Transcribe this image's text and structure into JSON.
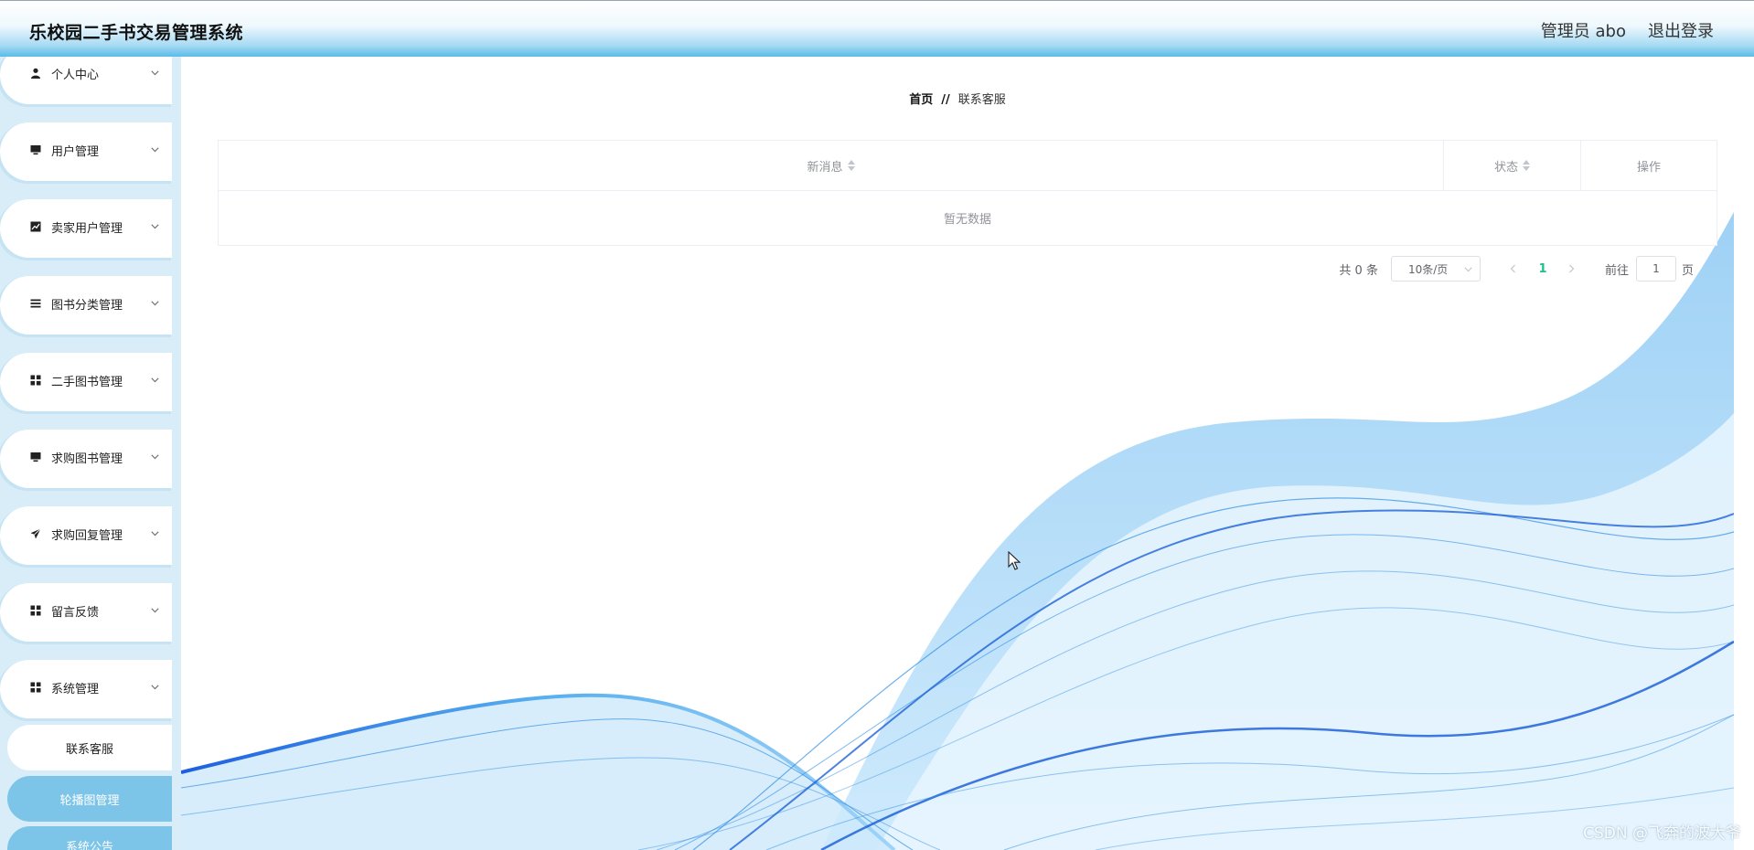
{
  "header": {
    "title": "乐校园二手书交易管理系统",
    "user_label": "管理员 abo",
    "logout_label": "退出登录"
  },
  "sidebar": {
    "items": [
      {
        "label": "个人中心",
        "icon": "user-icon"
      },
      {
        "label": "用户管理",
        "icon": "monitor-icon"
      },
      {
        "label": "卖家用户管理",
        "icon": "chart-icon"
      },
      {
        "label": "图书分类管理",
        "icon": "list-icon"
      },
      {
        "label": "二手图书管理",
        "icon": "grid-icon"
      },
      {
        "label": "求购图书管理",
        "icon": "monitor-icon"
      },
      {
        "label": "求购回复管理",
        "icon": "send-icon"
      },
      {
        "label": "留言反馈",
        "icon": "grid-icon"
      },
      {
        "label": "系统管理",
        "icon": "grid-icon"
      }
    ],
    "sub_items": [
      {
        "label": "联系客服",
        "active": true
      },
      {
        "label": "轮播图管理",
        "active": false
      },
      {
        "label": "系统公告",
        "active": false
      }
    ]
  },
  "breadcrumb": {
    "home": "首页",
    "separator": "//",
    "current": "联系客服"
  },
  "table": {
    "columns": [
      {
        "label": "新消息",
        "sortable": true
      },
      {
        "label": "状态",
        "sortable": true
      },
      {
        "label": "操作",
        "sortable": false
      }
    ],
    "empty_text": "暂无数据"
  },
  "pagination": {
    "total_text": "共 0 条",
    "page_size": "10条/页",
    "current_page": "1",
    "goto_label": "前往",
    "goto_value": "1",
    "page_unit": "页"
  },
  "watermark": "CSDN @飞奔的波大爷",
  "colors": {
    "sidebar_bg": "#d8edf8",
    "header_gradient_end": "#5bbbe9",
    "active_page": "#1ec08b",
    "sub_item_blue": "#7cc4e8",
    "wave_blue": "#2f8de4"
  }
}
